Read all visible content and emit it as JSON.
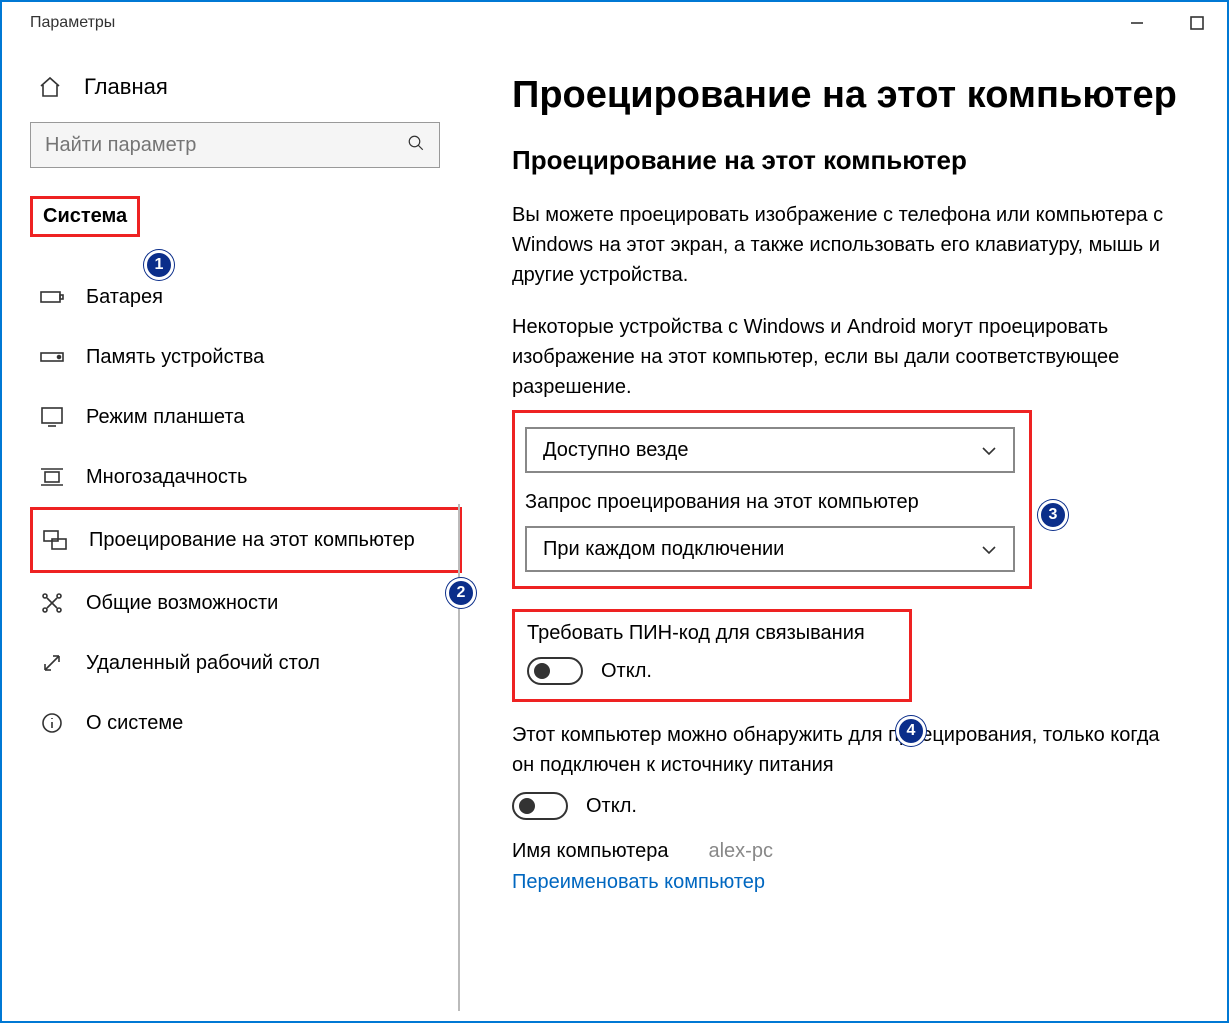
{
  "window": {
    "title": "Параметры"
  },
  "sidebar": {
    "home": "Главная",
    "search_placeholder": "Найти параметр",
    "breadcrumb": "Система",
    "items": [
      {
        "label": "Батарея",
        "icon": "battery-icon"
      },
      {
        "label": "Память устройства",
        "icon": "storage-icon"
      },
      {
        "label": "Режим планшета",
        "icon": "tablet-icon"
      },
      {
        "label": "Многозадачность",
        "icon": "multitask-icon"
      },
      {
        "label": "Проецирование на этот компьютер",
        "icon": "project-icon",
        "active": true
      },
      {
        "label": "Общие возможности",
        "icon": "shared-icon"
      },
      {
        "label": "Удаленный рабочий стол",
        "icon": "remote-icon"
      },
      {
        "label": "О системе",
        "icon": "about-icon"
      }
    ]
  },
  "main": {
    "title": "Проецирование на этот компьютер",
    "subtitle": "Проецирование на этот компьютер",
    "desc1": "Вы можете проецировать изображение с телефона или компьютера с Windows на этот экран, а также использовать его клавиатуру, мышь и другие устройства.",
    "desc2": "Некоторые устройства с Windows и Android могут проецировать изображение на этот компьютер, если вы дали соответствующее разрешение.",
    "availability_value": "Доступно везде",
    "request_label": "Запрос проецирования на этот компьютер",
    "request_value": "При каждом подключении",
    "pin_label": "Требовать ПИН-код для связывания",
    "pin_toggle": "Откл.",
    "power_label": "Этот компьютер можно обнаружить для проецирования, только когда он подключен к источнику питания",
    "power_toggle": "Откл.",
    "pcname_label": "Имя компьютера",
    "pcname_value": "alex-pc",
    "rename_link": "Переименовать компьютер"
  },
  "badges": {
    "1": "1",
    "2": "2",
    "3": "3",
    "4": "4"
  }
}
